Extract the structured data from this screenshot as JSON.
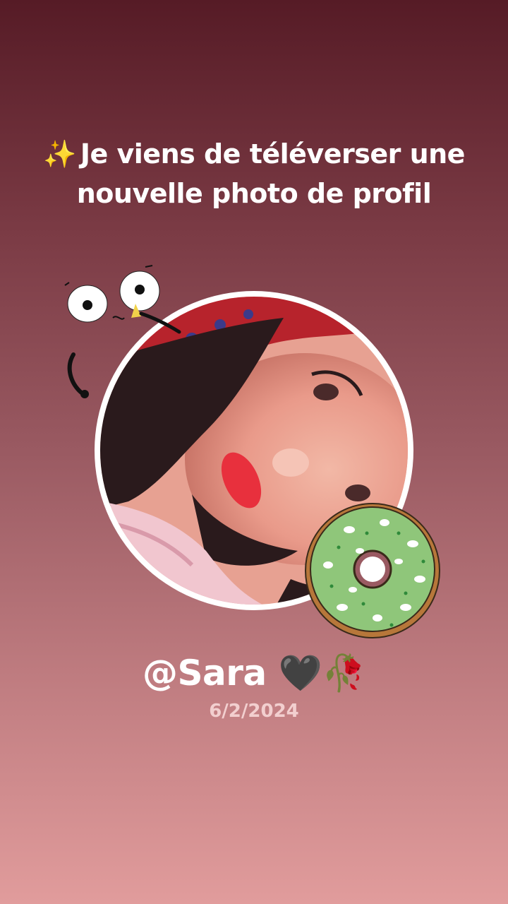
{
  "post": {
    "headline_emoji": "✨",
    "headline_text": "Je viens de téléverser une nouvelle photo de profil",
    "username": "@Sara",
    "username_emoji": "🖤🥀",
    "date": "6/2/2024"
  },
  "stickers": {
    "top_left": "googly-eyes-face-sticker",
    "bottom_right": "green-donut-sticker"
  },
  "colors": {
    "background_top": "#561b26",
    "background_bottom": "#e19c9c",
    "avatar_ring": "#ffffff",
    "text": "#ffffff",
    "date_text": "#f2cfcf",
    "donut_icing": "#8fc67a"
  }
}
